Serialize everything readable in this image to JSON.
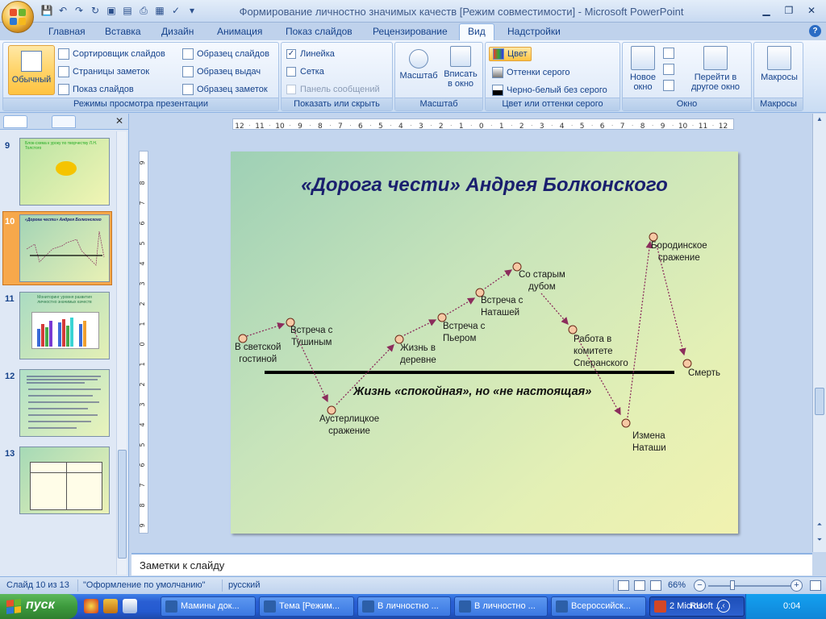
{
  "window": {
    "title": "Формирование личностно значимых качеств [Режим совместимости] - Microsoft PowerPoint"
  },
  "ribbon_tabs": [
    "Главная",
    "Вставка",
    "Дизайн",
    "Анимация",
    "Показ слайдов",
    "Рецензирование",
    "Вид",
    "Надстройки"
  ],
  "active_tab": "Вид",
  "ribbon": {
    "views": {
      "normal": "Обычный",
      "sorter": "Сортировщик слайдов",
      "notes_page": "Страницы заметок",
      "slideshow": "Показ слайдов",
      "slide_master": "Образец слайдов",
      "handout_master": "Образец выдач",
      "notes_master": "Образец заметок",
      "label": "Режимы просмотра презентации"
    },
    "show": {
      "ruler": "Линейка",
      "grid": "Сетка",
      "message_bar": "Панель сообщений",
      "label": "Показать или скрыть",
      "ruler_checked": true,
      "grid_checked": false
    },
    "zoom": {
      "zoom": "Масштаб",
      "fit": "Вписать в окно",
      "label": "Масштаб"
    },
    "color": {
      "color": "Цвет",
      "grayscale": "Оттенки серого",
      "bw": "Черно-белый без серого",
      "label": "Цвет или оттенки серого"
    },
    "window": {
      "new_window": "Новое окно",
      "switch": "Перейти в другое окно",
      "label": "Окно"
    },
    "macros": {
      "macros": "Макросы",
      "label": "Макросы"
    }
  },
  "thumbnails": [
    {
      "num": "9",
      "title": "Блок-схема к уроку по творчеству Л.Н. Толстого"
    },
    {
      "num": "10",
      "title": "«Дорога чести» Андрея Болконского",
      "selected": true
    },
    {
      "num": "11",
      "title": "Мониторинг уровня развития личностно значимых качеств"
    },
    {
      "num": "12",
      "title": ""
    },
    {
      "num": "13",
      "title": ""
    }
  ],
  "slide": {
    "title": "«Дорога чести» Андрея Болконского",
    "subtitle": "Жизнь «спокойная», но  «не настоящая»",
    "labels": {
      "salon": "В светской\nгостиной",
      "tushin": "Встреча с\nТушиным",
      "austerlitz": "Аустерлицкое\nсражение",
      "village": "Жизнь в\nдеревне",
      "pierre": "Встреча с\nПьером",
      "natasha": "Встреча с\nНаташей",
      "oak": "Со старым\nдубом",
      "speransky": "Работа в\nкомитете\nСперанского",
      "betrayal": "Измена\nНаташи",
      "borodino": "Бородинское\nсражение",
      "death": "Смерть"
    }
  },
  "notes_placeholder": "Заметки к слайду",
  "status": {
    "slide_counter": "Слайд 10 из 13",
    "theme": "\"Оформление по умолчанию\"",
    "language": "русский",
    "zoom": "66%"
  },
  "taskbar": {
    "start": "пуск",
    "tasks": [
      "Мамины док...",
      "Тема [Режим...",
      "В личностно ...",
      "В личностно ...",
      "Всероссийск...",
      "2 Microsoft ..."
    ],
    "lang": "RU",
    "clock": "0:04"
  },
  "colors": {
    "title_text": "#1a1f6e",
    "node_fill": "#f6c9a4",
    "arrow": "#8b2d5c"
  }
}
